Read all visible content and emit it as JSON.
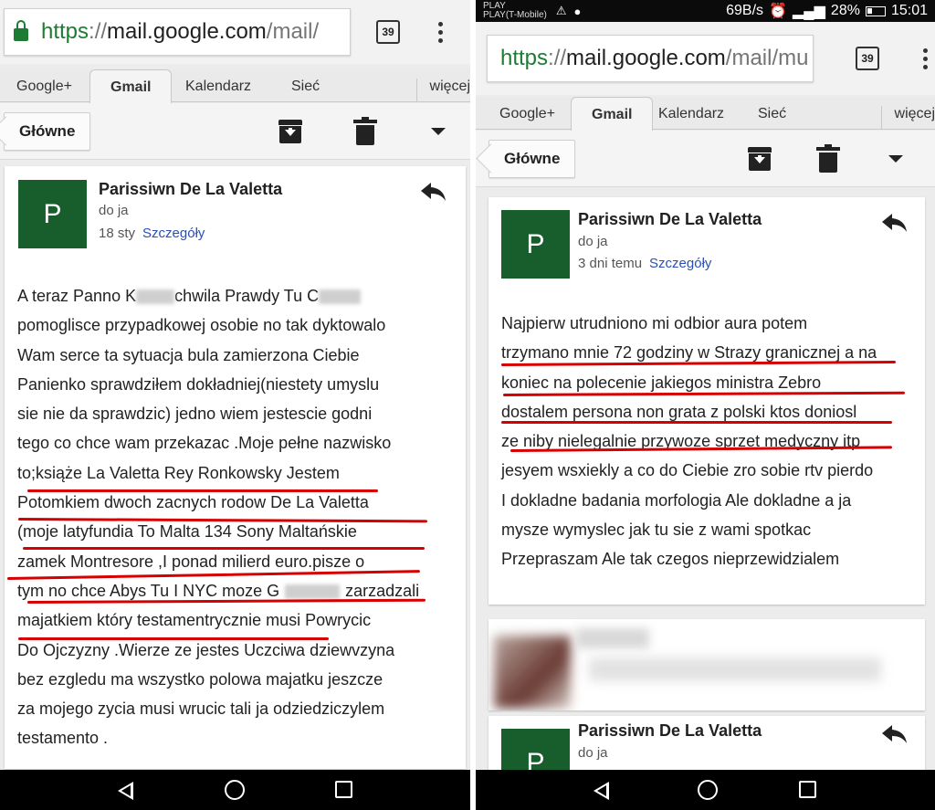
{
  "status_bar": {
    "carrier_top": "PLAY",
    "carrier": "PLAY(T-Mobile)",
    "speed": "69B/s",
    "battery": "28%",
    "time": "15:01"
  },
  "left": {
    "url": {
      "scheme": "https",
      "sep": "://",
      "host": "mail.google.com",
      "path": "/mail/"
    },
    "tab_count": "39",
    "google_bar": {
      "items": [
        "Google+",
        "Gmail",
        "Kalendarz",
        "Sieć"
      ],
      "more": "więcej"
    },
    "toolbar": {
      "back_label": "Główne"
    },
    "message": {
      "avatar_letter": "P",
      "sender": "Parissiwn De La Valetta",
      "to": "do ja",
      "date": "18 sty",
      "details": "Szczegóły",
      "lines": [
        [
          "A teraz Panno K",
          "chwila Prawdy Tu C"
        ],
        [
          "pomoglisce przypadkowej osobie no tak dyktowalo"
        ],
        [
          "Wam serce ta sytuacja bula zamierzona Ciebie"
        ],
        [
          "Panienko sprawdziłem dokładniej(niestety umyslu"
        ],
        [
          "sie nie da sprawdzic) jedno wiem jestescie godni"
        ],
        [
          "tego co chce wam przekazac .Moje pełne nazwisko"
        ],
        [
          "to;książe La Valetta Rey Ronkowsky Jestem"
        ],
        [
          "Potomkiem dwoch zacnych rodow De La Valetta"
        ],
        [
          "(moje latyfundia To Malta 134 Sony Maltańskie"
        ],
        [
          "zamek Montresore ,I ponad milierd euro.pisze o"
        ],
        [
          "tym no chce Abys Tu I NYC moze G",
          "zarzadzali"
        ],
        [
          "majatkiem który testamentrycznie musi Powrycic"
        ],
        [
          "Do Ojczyzny .Wierze ze jestes Uczciwa dziewvzyna"
        ],
        [
          "bez ezgledu ma wszystko polowa majatku jeszcze"
        ],
        [
          "za mojego zycia musi wrucic tali ja odziedziczylem"
        ],
        [
          "testamento ."
        ]
      ]
    }
  },
  "right": {
    "url": {
      "scheme": "https",
      "sep": "://",
      "host": "mail.google.com",
      "path": "/mail/mu"
    },
    "tab_count": "39",
    "google_bar": {
      "items": [
        "Google+",
        "Gmail",
        "Kalendarz",
        "Sieć"
      ],
      "more": "więcej"
    },
    "toolbar": {
      "back_label": "Główne"
    },
    "message": {
      "avatar_letter": "P",
      "sender": "Parissiwn De La Valetta",
      "to": "do ja",
      "date": "3 dni temu",
      "details": "Szczegóły",
      "lines": [
        "Najpierw utrudniono mi odbior aura potem",
        "trzymano mnie 72 godziny w Strazy granicznej a na",
        "koniec na polecenie jakiegos ministra Zebro",
        "dostalem persona non grata z polski ktos doniosl",
        "ze niby nielegalnie przywoze sprzet medyczny itp",
        "jesyem wsxiekly a co do Ciebie zro sobie rtv pierdo",
        "I dokladne badania morfologia Ale dokladne a ja",
        "mysze wymyslec jak tu sie z wami spotkac",
        "Przepraszam Ale tak czegos nieprzewidzialem"
      ]
    },
    "second_message": {
      "avatar_letter": "P",
      "sender": "Parissiwn De La Valetta",
      "to": "do ja"
    }
  },
  "colors": {
    "avatar": "#175e2c",
    "secure_green": "#1e7b34",
    "details_link": "#2a4fb8",
    "underline_red": "#d60000"
  }
}
